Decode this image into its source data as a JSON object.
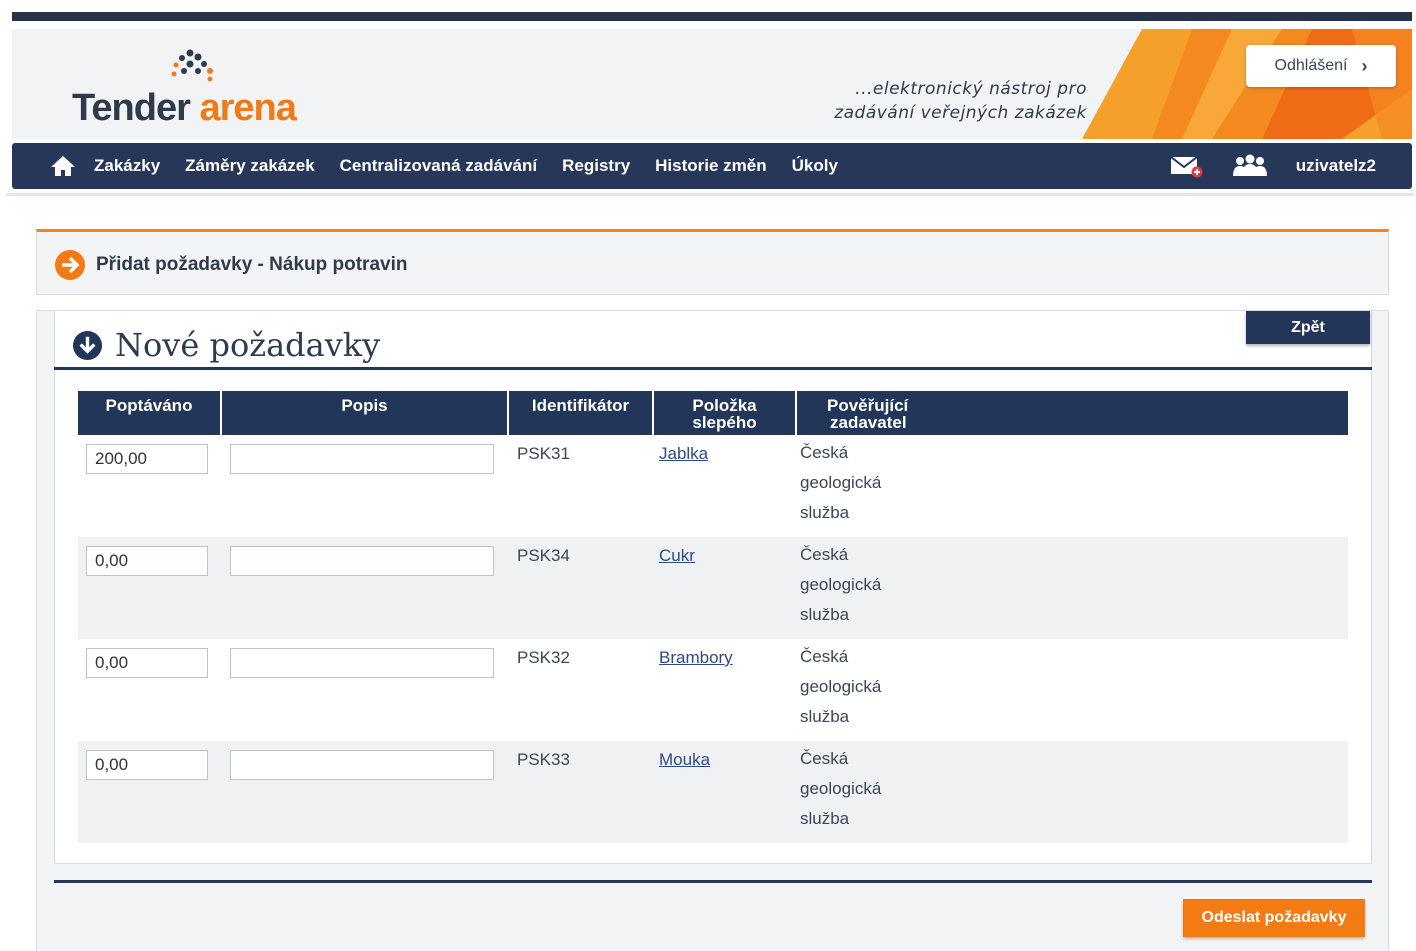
{
  "header": {
    "logo": {
      "tender": "Tender",
      "arena": "arena"
    },
    "tagline_line1": "...elektronický nástroj pro",
    "tagline_line2": "zadávání veřejných zakázek",
    "logout_label": "Odhlášení",
    "logout_icon": "chevron-right-icon"
  },
  "nav": {
    "home_icon": "home-icon",
    "items": [
      "Zakázky",
      "Záměry zakázek",
      "Centralizovaná zadávání",
      "Registry",
      "Historie změn",
      "Úkoly"
    ],
    "mail_icon": "mail-new-icon",
    "users_icon": "users-icon",
    "user": "uzivatelz2"
  },
  "breadcrumb": {
    "icon": "arrow-right-circle-icon",
    "text": "Přidat požadavky - Nákup potravin"
  },
  "section": {
    "icon": "arrow-down-circle-icon",
    "title": "Nové požadavky",
    "back_label": "Zpět"
  },
  "table": {
    "headers": {
      "qty": "Poptáváno",
      "desc": "Popis",
      "id": "Identifikátor",
      "item_line1": "Položka",
      "item_line2": "slepého",
      "sponsor_line1": "Pověřující",
      "sponsor_line2": "zadavatel"
    },
    "rows": [
      {
        "qty": "200,00",
        "desc": "",
        "id": "PSK31",
        "item": "Jablka",
        "sponsor": [
          "Česká",
          "geologická",
          "služba"
        ]
      },
      {
        "qty": "0,00",
        "desc": "",
        "id": "PSK34",
        "item": "Cukr",
        "sponsor": [
          "Česká",
          "geologická",
          "služba"
        ]
      },
      {
        "qty": "0,00",
        "desc": "",
        "id": "PSK32",
        "item": "Brambory",
        "sponsor": [
          "Česká",
          "geologická",
          "služba"
        ]
      },
      {
        "qty": "0,00",
        "desc": "",
        "id": "PSK33",
        "item": "Mouka",
        "sponsor": [
          "Česká",
          "geologická",
          "služba"
        ]
      }
    ]
  },
  "footer": {
    "submit_label": "Odeslat požadavky"
  },
  "colors": {
    "navy": "#26375a",
    "orange": "#f58220",
    "link": "#2d4a8a"
  }
}
